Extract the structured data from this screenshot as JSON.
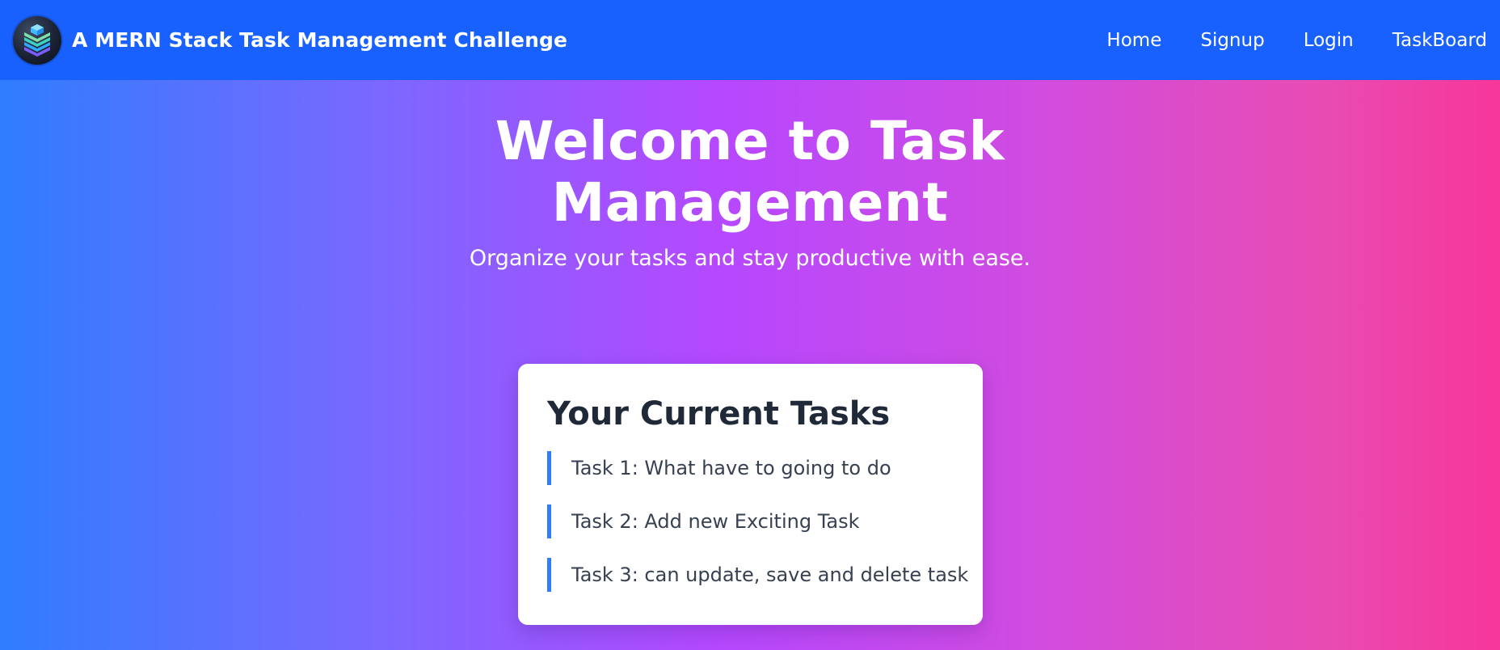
{
  "navbar": {
    "brand_title": "A MERN Stack Task Management Challenge",
    "logo_icon": "layered-stack-logo-icon",
    "links": [
      {
        "label": "Home"
      },
      {
        "label": "Signup"
      },
      {
        "label": "Login"
      },
      {
        "label": "TaskBoard"
      }
    ],
    "background_color": "#1861ff"
  },
  "hero": {
    "title_line1": "Welcome to Task",
    "title_line2": "Management",
    "subtitle": "Organize your tasks and stay productive with ease.",
    "gradient_colors": [
      "#2f7dff",
      "#b648ff",
      "#f7369a"
    ]
  },
  "tasks_card": {
    "title": "Your Current Tasks",
    "items": [
      {
        "text": "Task 1: What have to going to do"
      },
      {
        "text": "Task 2: Add new Exciting Task"
      },
      {
        "text": "Task 3: can update, save and delete task"
      }
    ],
    "accent_color": "#2f7dff"
  }
}
